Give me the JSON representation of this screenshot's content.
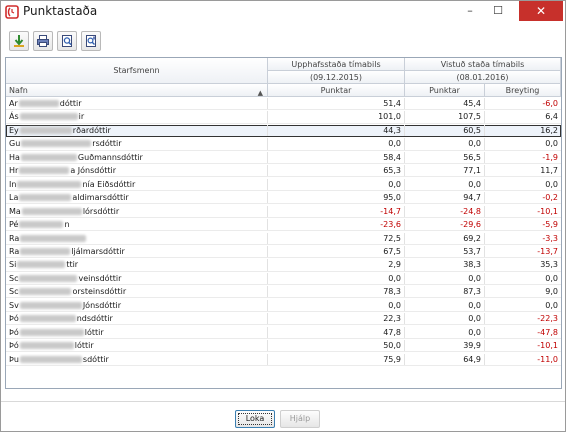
{
  "window": {
    "title": "Punktastaða",
    "min_glyph": "–",
    "max_glyph": "☐",
    "close_glyph": "✕"
  },
  "toolbar": {
    "buttons": [
      {
        "name": "export-button",
        "icon": "export-icon"
      },
      {
        "name": "print-button",
        "icon": "print-icon"
      },
      {
        "name": "preview-button",
        "icon": "print-preview-icon"
      },
      {
        "name": "page-setup-button",
        "icon": "page-setup-icon"
      }
    ]
  },
  "table": {
    "group_headers": {
      "staff": "Starfsmenn",
      "start_title": "Upphafsstaða tímabils",
      "start_date": "(09.12.2015)",
      "end_title": "Vistuð staða tímabils",
      "end_date": "(08.01.2016)"
    },
    "columns": {
      "name": "Nafn",
      "start_points": "Punktar",
      "end_points": "Punktar",
      "change": "Breyting"
    },
    "rows": [
      {
        "pre": "Ar",
        "post": "dóttir",
        "start": "51,4",
        "end": "45,4",
        "change": "-6,0"
      },
      {
        "pre": "Ás",
        "post": "ir",
        "start": "101,0",
        "end": "107,5",
        "change": "6,4"
      },
      {
        "pre": "Ey",
        "post": "rðardóttir",
        "start": "44,3",
        "end": "60,5",
        "change": "16,2",
        "selected": true
      },
      {
        "pre": "Gu",
        "post": "rsdóttir",
        "start": "0,0",
        "end": "0,0",
        "change": "0,0"
      },
      {
        "pre": "Ha",
        "post": "Guðmannsdóttir",
        "start": "58,4",
        "end": "56,5",
        "change": "-1,9"
      },
      {
        "pre": "Hr",
        "post": "a Jónsdóttir",
        "start": "65,3",
        "end": "77,1",
        "change": "11,7"
      },
      {
        "pre": "In",
        "post": "nía Eiðsdóttir",
        "start": "0,0",
        "end": "0,0",
        "change": "0,0"
      },
      {
        "pre": "La",
        "post": "aldimarsdóttir",
        "start": "95,0",
        "end": "94,7",
        "change": "-0,2"
      },
      {
        "pre": "Ma",
        "post": "lórsdóttir",
        "start": "-14,7",
        "end": "-24,8",
        "change": "-10,1"
      },
      {
        "pre": "Pé",
        "post": "n",
        "start": "-23,6",
        "end": "-29,6",
        "change": "-5,9"
      },
      {
        "pre": "Ra",
        "post": "",
        "start": "72,5",
        "end": "69,2",
        "change": "-3,3"
      },
      {
        "pre": "Ra",
        "post": "ljálmarsdóttir",
        "start": "67,5",
        "end": "53,7",
        "change": "-13,7"
      },
      {
        "pre": "Si",
        "post": "ttir",
        "start": "2,9",
        "end": "38,3",
        "change": "35,3"
      },
      {
        "pre": "Sc",
        "post": "veinsdóttir",
        "start": "0,0",
        "end": "0,0",
        "change": "0,0"
      },
      {
        "pre": "Sc",
        "post": "orsteinsdóttir",
        "start": "78,3",
        "end": "87,3",
        "change": "9,0"
      },
      {
        "pre": "Sv",
        "post": "Jónsdóttir",
        "start": "0,0",
        "end": "0,0",
        "change": "0,0"
      },
      {
        "pre": "Þó",
        "post": "ndsdóttir",
        "start": "22,3",
        "end": "0,0",
        "change": "-22,3"
      },
      {
        "pre": "Þó",
        "post": "lóttir",
        "start": "47,8",
        "end": "0,0",
        "change": "-47,8"
      },
      {
        "pre": "Þó",
        "post": "lóttir",
        "start": "50,0",
        "end": "39,9",
        "change": "-10,1"
      },
      {
        "pre": "Þu",
        "post": "sdóttir",
        "start": "75,9",
        "end": "64,9",
        "change": "-11,0"
      }
    ]
  },
  "footer": {
    "close_label": "Loka",
    "help_label": "Hjálp"
  },
  "colors": {
    "negative": "#c00000",
    "close_button": "#c7302b"
  }
}
